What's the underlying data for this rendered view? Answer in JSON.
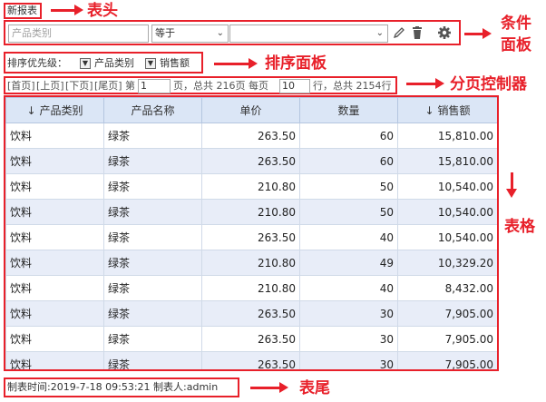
{
  "header": {
    "title": "新报表"
  },
  "condition": {
    "field_placeholder": "产品类别",
    "operator": "等于",
    "value": ""
  },
  "sort": {
    "label": "排序优先级：",
    "items": [
      "产品类别",
      "销售额"
    ]
  },
  "pager": {
    "first": "[首页]",
    "prev": "[上页]",
    "next": "[下页]",
    "last": "[尾页]",
    "page_prefix": "第",
    "page_value": "1",
    "page_mid": "页，总共 216页 每页",
    "per_page_value": "10",
    "rows_suffix": "行，总共 2154行"
  },
  "table": {
    "columns": [
      "产品类别",
      "产品名称",
      "单价",
      "数量",
      "销售额"
    ],
    "rows": [
      [
        "饮料",
        "绿茶",
        "263.50",
        "60",
        "15,810.00"
      ],
      [
        "饮料",
        "绿茶",
        "263.50",
        "60",
        "15,810.00"
      ],
      [
        "饮料",
        "绿茶",
        "210.80",
        "50",
        "10,540.00"
      ],
      [
        "饮料",
        "绿茶",
        "210.80",
        "50",
        "10,540.00"
      ],
      [
        "饮料",
        "绿茶",
        "263.50",
        "40",
        "10,540.00"
      ],
      [
        "饮料",
        "绿茶",
        "210.80",
        "49",
        "10,329.20"
      ],
      [
        "饮料",
        "绿茶",
        "210.80",
        "40",
        "8,432.00"
      ],
      [
        "饮料",
        "绿茶",
        "263.50",
        "30",
        "7,905.00"
      ],
      [
        "饮料",
        "绿茶",
        "263.50",
        "30",
        "7,905.00"
      ],
      [
        "饮料",
        "绿茶",
        "263.50",
        "30",
        "7,905.00"
      ]
    ]
  },
  "footer": {
    "text": "制表时间:2019-7-18 09:53:21 制表人:admin"
  },
  "annotations": {
    "header": "表头",
    "condition_line1": "条件",
    "condition_line2": "面板",
    "sort": "排序面板",
    "pager": "分页控制器",
    "table": "表格",
    "footer": "表尾"
  },
  "icons": {
    "edit": "pencil-icon",
    "delete": "trash-icon",
    "settings": "gear-icon",
    "dropdown": "chevron-down-icon",
    "sort_desc": "arrow-down-icon"
  },
  "colors": {
    "annotation": "#e8202a",
    "header_bg": "#dbe6f6",
    "row_alt": "#e8edf8"
  }
}
